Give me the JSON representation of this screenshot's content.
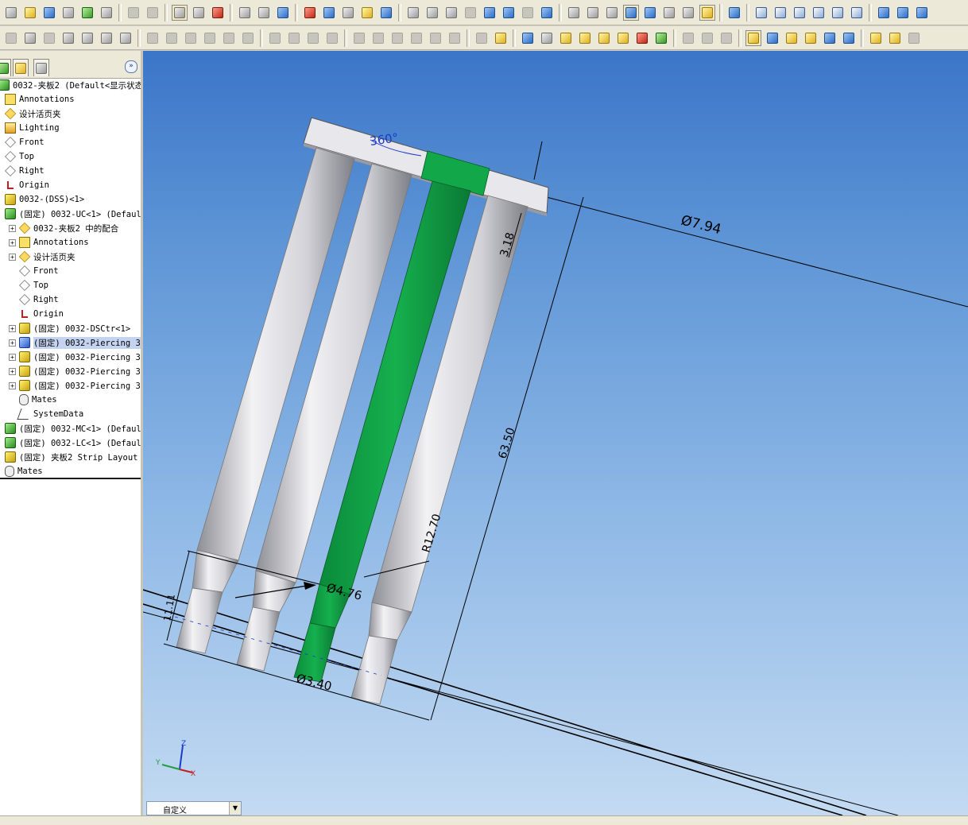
{
  "toolbar_top": {
    "icons": [
      {
        "name": "new-document-icon",
        "kind": "gray"
      },
      {
        "name": "open-folder-icon",
        "kind": "yellow"
      },
      {
        "name": "save-icon",
        "kind": "blue"
      },
      {
        "name": "print-preview-icon",
        "kind": "gray"
      },
      {
        "name": "options-icon",
        "kind": "green"
      },
      {
        "name": "print-icon",
        "kind": "gray"
      },
      {
        "name": "undo-icon",
        "kind": "dim"
      },
      {
        "name": "redo-icon",
        "kind": "dim"
      },
      {
        "name": "select-arrow-icon",
        "kind": "gray",
        "active": true
      },
      {
        "name": "select-filter-icon",
        "kind": "gray"
      },
      {
        "name": "traffic-light-icon",
        "kind": "red"
      },
      {
        "name": "grid-icon",
        "kind": "gray"
      },
      {
        "name": "sketch-icon",
        "kind": "gray"
      },
      {
        "name": "smart-mates-icon",
        "kind": "blue"
      },
      {
        "name": "3d-part-icon",
        "kind": "red"
      },
      {
        "name": "window-layout-icon",
        "kind": "blue"
      },
      {
        "name": "properties-icon",
        "kind": "gray"
      },
      {
        "name": "help-icon",
        "kind": "yellow"
      },
      {
        "name": "measure-icon",
        "kind": "blue"
      },
      {
        "name": "zoom-fit-icon",
        "kind": "gray"
      },
      {
        "name": "zoom-area-icon",
        "kind": "gray"
      },
      {
        "name": "zoom-in-out-icon",
        "kind": "gray"
      },
      {
        "name": "zoom-selection-icon",
        "kind": "dim"
      },
      {
        "name": "rotate-icon",
        "kind": "blue"
      },
      {
        "name": "pan-icon",
        "kind": "blue"
      },
      {
        "name": "roll-view-icon",
        "kind": "dim"
      },
      {
        "name": "view-orientation-icon",
        "kind": "blue"
      },
      {
        "name": "wireframe-icon",
        "kind": "gray"
      },
      {
        "name": "hidden-lines-visible-icon",
        "kind": "gray"
      },
      {
        "name": "hidden-lines-removed-icon",
        "kind": "gray"
      },
      {
        "name": "shaded-with-edges-icon",
        "kind": "blue",
        "active": true
      },
      {
        "name": "shaded-icon",
        "kind": "blue"
      },
      {
        "name": "section-view-icon",
        "kind": "gray"
      },
      {
        "name": "realview-icon",
        "kind": "gray"
      },
      {
        "name": "shadows-icon",
        "kind": "yellow",
        "active": true
      },
      {
        "name": "normal-to-icon",
        "kind": "blue"
      },
      {
        "name": "front-view-icon",
        "kind": "cube"
      },
      {
        "name": "back-view-icon",
        "kind": "cube"
      },
      {
        "name": "left-view-icon",
        "kind": "cube"
      },
      {
        "name": "right-view-icon",
        "kind": "cube"
      },
      {
        "name": "top-view-icon",
        "kind": "cube"
      },
      {
        "name": "bottom-view-icon",
        "kind": "cube"
      },
      {
        "name": "isometric-view-icon",
        "kind": "blue"
      },
      {
        "name": "trimetric-view-icon",
        "kind": "blue"
      },
      {
        "name": "dimetric-view-icon",
        "kind": "blue"
      }
    ]
  },
  "toolbar_second": {
    "icons": [
      {
        "name": "sheet-metal-icon",
        "kind": "dim"
      },
      {
        "name": "base-flange-icon",
        "kind": "gray"
      },
      {
        "name": "edge-flange-icon",
        "kind": "dim"
      },
      {
        "name": "insert-bends-icon",
        "kind": "gray"
      },
      {
        "name": "flatten-icon",
        "kind": "gray"
      },
      {
        "name": "move-component-icon",
        "kind": "gray"
      },
      {
        "name": "rotate-component-icon",
        "kind": "gray"
      },
      {
        "name": "mold-tools-icon",
        "kind": "dim"
      },
      {
        "name": "parting-line-icon",
        "kind": "dim"
      },
      {
        "name": "shut-off-icon",
        "kind": "dim"
      },
      {
        "name": "core-icon",
        "kind": "dim"
      },
      {
        "name": "draft-analysis-icon",
        "kind": "dim"
      },
      {
        "name": "undercut-icon",
        "kind": "dim"
      },
      {
        "name": "scale-icon",
        "kind": "dim"
      },
      {
        "name": "ruled-surface-icon",
        "kind": "dim"
      },
      {
        "name": "tooling-split-icon",
        "kind": "dim"
      },
      {
        "name": "cavity-icon",
        "kind": "dim"
      },
      {
        "name": "weldment-icon",
        "kind": "dim"
      },
      {
        "name": "structural-member-icon",
        "kind": "dim"
      },
      {
        "name": "trim-extend-icon",
        "kind": "dim"
      },
      {
        "name": "end-cap-icon",
        "kind": "dim"
      },
      {
        "name": "gusset-icon",
        "kind": "dim"
      },
      {
        "name": "fillet-bead-icon",
        "kind": "dim"
      },
      {
        "name": "explode-icon",
        "kind": "dim"
      },
      {
        "name": "assembly-features-icon",
        "kind": "yellow"
      },
      {
        "name": "bom-icon",
        "kind": "blue"
      },
      {
        "name": "component-properties-icon",
        "kind": "gray"
      },
      {
        "name": "route-line-icon",
        "kind": "yellow"
      },
      {
        "name": "route-bend-icon",
        "kind": "yellow"
      },
      {
        "name": "route-spline-icon",
        "kind": "yellow"
      },
      {
        "name": "fitting-icon",
        "kind": "yellow"
      },
      {
        "name": "connector-icon",
        "kind": "red"
      },
      {
        "name": "clip-icon",
        "kind": "green"
      },
      {
        "name": "hide-show-icon",
        "kind": "dim"
      },
      {
        "name": "transparency-icon",
        "kind": "dim"
      },
      {
        "name": "change-display-icon",
        "kind": "dim"
      },
      {
        "name": "appearance-edit-icon",
        "kind": "yellow",
        "active": true
      },
      {
        "name": "appearance-copy-icon",
        "kind": "blue"
      },
      {
        "name": "appearance-paste-icon",
        "kind": "yellow"
      },
      {
        "name": "appearance-remove-icon",
        "kind": "yellow"
      },
      {
        "name": "texture-icon",
        "kind": "blue"
      },
      {
        "name": "decal-icon",
        "kind": "blue"
      },
      {
        "name": "scene-icon",
        "kind": "yellow"
      },
      {
        "name": "lights-icon",
        "kind": "yellow"
      },
      {
        "name": "camera-icon",
        "kind": "dim"
      }
    ]
  },
  "feature_manager": {
    "tabs": [
      {
        "name": "tab-featuremanager-icon",
        "kind": "green"
      },
      {
        "name": "tab-propertymanager-icon",
        "kind": "yellow"
      },
      {
        "name": "tab-configurationmanager-icon",
        "kind": "gray"
      }
    ],
    "expand_label": "»",
    "tree": [
      {
        "text": "0032-夹板2  (Default<显示状态",
        "icon": "asm",
        "indent": 0,
        "toggle": ""
      },
      {
        "text": "Annotations",
        "icon": "annot",
        "indent": 1,
        "toggle": ""
      },
      {
        "text": "设计活页夹",
        "icon": "folder",
        "indent": 1,
        "toggle": ""
      },
      {
        "text": "Lighting",
        "icon": "light",
        "indent": 1,
        "toggle": ""
      },
      {
        "text": "Front",
        "icon": "plane",
        "indent": 1,
        "toggle": ""
      },
      {
        "text": "Top",
        "icon": "plane",
        "indent": 1,
        "toggle": ""
      },
      {
        "text": "Right",
        "icon": "plane",
        "indent": 1,
        "toggle": ""
      },
      {
        "text": "Origin",
        "icon": "origin",
        "indent": 1,
        "toggle": ""
      },
      {
        "text": "0032-(DSS)<1>",
        "icon": "part",
        "indent": 1,
        "toggle": ""
      },
      {
        "text": "(固定) 0032-UC<1> (Defaul",
        "icon": "asm",
        "indent": 1,
        "toggle": ""
      },
      {
        "text": "0032-夹板2 中的配合",
        "icon": "folder",
        "indent": 2,
        "toggle": "+"
      },
      {
        "text": "Annotations",
        "icon": "annot",
        "indent": 2,
        "toggle": "+"
      },
      {
        "text": "设计活页夹",
        "icon": "folder",
        "indent": 2,
        "toggle": "+"
      },
      {
        "text": "Front",
        "icon": "plane",
        "indent": 2,
        "toggle": ""
      },
      {
        "text": "Top",
        "icon": "plane",
        "indent": 2,
        "toggle": ""
      },
      {
        "text": "Right",
        "icon": "plane",
        "indent": 2,
        "toggle": ""
      },
      {
        "text": "Origin",
        "icon": "origin",
        "indent": 2,
        "toggle": ""
      },
      {
        "text": "(固定) 0032-DSCtr<1>",
        "icon": "part",
        "indent": 2,
        "toggle": "+"
      },
      {
        "text": "(固定) 0032-Piercing 3",
        "icon": "partblue",
        "indent": 2,
        "toggle": "+",
        "selected": true
      },
      {
        "text": "(固定) 0032-Piercing 3",
        "icon": "part",
        "indent": 2,
        "toggle": "+"
      },
      {
        "text": "(固定) 0032-Piercing 3",
        "icon": "part",
        "indent": 2,
        "toggle": "+"
      },
      {
        "text": "(固定) 0032-Piercing 3",
        "icon": "part",
        "indent": 2,
        "toggle": "+"
      },
      {
        "text": "Mates",
        "icon": "mates",
        "indent": 2,
        "toggle": ""
      },
      {
        "text": "SystemData",
        "icon": "sysdata",
        "indent": 2,
        "toggle": ""
      },
      {
        "text": "(固定) 0032-MC<1> (Defaul",
        "icon": "asm",
        "indent": 1,
        "toggle": ""
      },
      {
        "text": "(固定) 0032-LC<1> (Defaul",
        "icon": "asm",
        "indent": 1,
        "toggle": ""
      },
      {
        "text": "(固定) 夹板2 Strip Layout",
        "icon": "part",
        "indent": 1,
        "toggle": ""
      },
      {
        "text": "Mates",
        "icon": "mates",
        "indent": 1,
        "toggle": ""
      }
    ]
  },
  "viewport": {
    "dimensions": [
      {
        "label": "360°",
        "color": "#1a3ac8"
      },
      {
        "label": "Ø7.94",
        "color": "#000000"
      },
      {
        "label": "3.18",
        "color": "#000000"
      },
      {
        "label": "63.50",
        "color": "#000000"
      },
      {
        "label": "R12.70",
        "color": "#000000"
      },
      {
        "label": "Ø4.76",
        "color": "#000000"
      },
      {
        "label": "Ø3.40",
        "color": "#000000"
      },
      {
        "label": "11.11",
        "color": "#000000"
      }
    ],
    "triad": {
      "x": "X",
      "y": "Y",
      "z": "Z"
    },
    "colors": {
      "punch_gray": "#d0d0d4",
      "highlight_green": "#10a04a",
      "bg_top": "#3b75c8",
      "bg_bottom": "#c3daf2"
    }
  },
  "status": {
    "config_combo": "自定义"
  }
}
